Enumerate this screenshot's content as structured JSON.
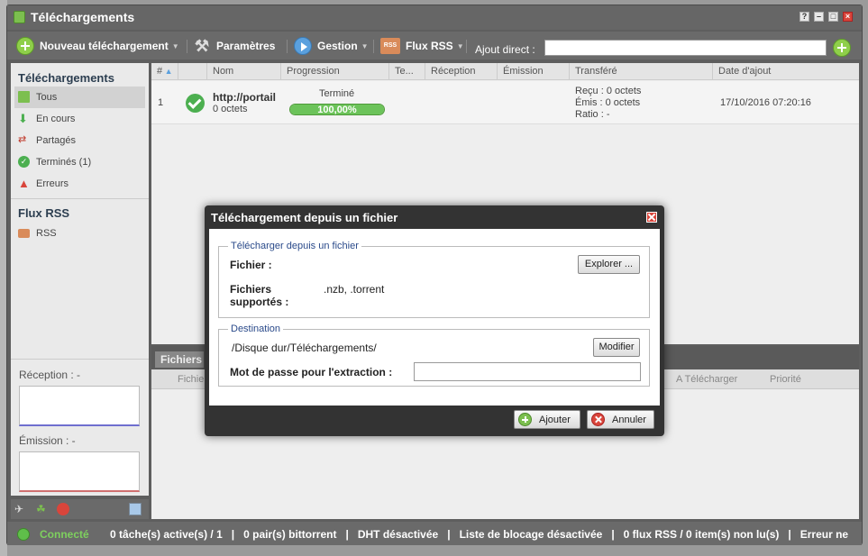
{
  "window": {
    "title": "Téléchargements",
    "controls": [
      "?",
      "–",
      "□",
      "×"
    ]
  },
  "toolbar": {
    "new_download": "Nouveau téléchargement",
    "settings": "Paramètres",
    "manage": "Gestion",
    "rss": "Flux RSS",
    "direct_add_label": "Ajout direct :",
    "direct_add_value": ""
  },
  "sidebar": {
    "downloads_heading": "Téléchargements",
    "items": [
      {
        "label": "Tous",
        "icon": "download-all-icon"
      },
      {
        "label": "En cours",
        "icon": "arrow-down-icon"
      },
      {
        "label": "Partagés",
        "icon": "share-arrows-icon"
      },
      {
        "label": "Terminés (1)",
        "icon": "check-circle-icon"
      },
      {
        "label": "Erreurs",
        "icon": "warning-icon"
      }
    ],
    "rss_heading": "Flux RSS",
    "rss_items": [
      {
        "label": "RSS",
        "icon": "rss-icon"
      }
    ],
    "reception_label": "Réception : -",
    "emission_label": "Émission : -"
  },
  "grid": {
    "columns": [
      "#",
      "",
      "Nom",
      "Progression",
      "Te...",
      "Réception",
      "Émission",
      "Transféré",
      "Date d'ajout"
    ],
    "rows": [
      {
        "index": "1",
        "name": "http://portail",
        "size": "0 octets",
        "status": "Terminé",
        "progress_label": "100,00%",
        "progress": 1.0,
        "received": "Reçu : 0 octets",
        "sent": "Émis : 0 octets",
        "ratio": "Ratio : -",
        "date_added": "17/10/2016 07:20:16"
      }
    ]
  },
  "lower_panel": {
    "tab": "Fichiers",
    "columns": [
      "Fichier",
      "A Télécharger",
      "Priorité"
    ]
  },
  "status_bar": {
    "connected": "Connecté",
    "tasks": "0 tâche(s) active(s) / 1",
    "peers": "0 pair(s) bittorrent",
    "dht": "DHT désactivée",
    "blocklist": "Liste de blocage désactivée",
    "rss": "0 flux RSS / 0 item(s) non lu(s)",
    "error": "Erreur ne"
  },
  "dialog": {
    "title": "Téléchargement depuis un fichier",
    "source_legend": "Télécharger depuis un fichier",
    "file_label": "Fichier :",
    "browse_button": "Explorer ...",
    "supported_label_line1": "Fichiers",
    "supported_label_line2": "supportés :",
    "supported_value": ".nzb, .torrent",
    "destination_legend": "Destination",
    "destination_path": "/Disque dur/Téléchargements/",
    "modify_button": "Modifier",
    "password_label": "Mot de passe pour l'extraction :",
    "password_value": "",
    "add_button": "Ajouter",
    "cancel_button": "Annuler"
  }
}
